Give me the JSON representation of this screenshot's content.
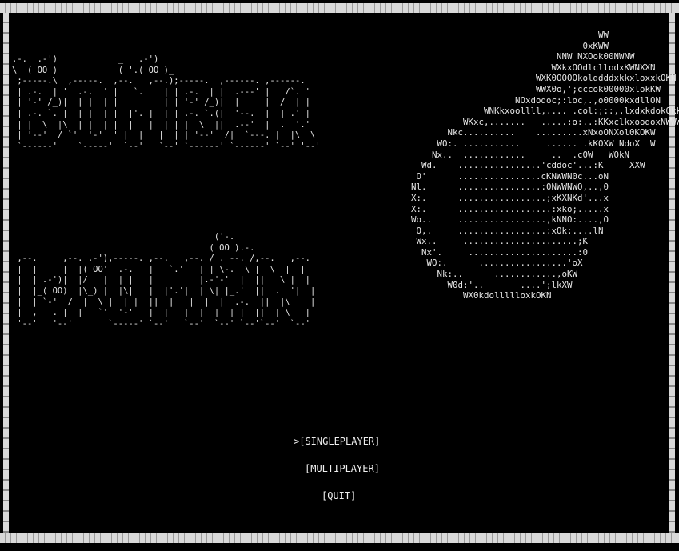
{
  "title": {
    "bomber_ascii": ".-.  .-')            _   .-')\n\\  ( OO )            ( '.( OO )_\n ;-----.\\  ,-----.  ,--.   ,--.);-----.  ,------. ,------.\n | .-.  | '  .-.  ' |   `.'   | | .-.  | |  .---' |   /`. '\n | '-' /_)|  | |  | |         | | '-' /_)|  |     |  /  | |\n | .-. `. |  | |  | |  |'.'|  | | .-. `.(|  '--.  |  |_.' |\n | |  \\  |\\  | |  | |  |   |  | | |  \\  ||  .--'  |  .  '.'\n | '--'  / `'  '-'  ' |  |   |  | | '--'  /|  `---. |  |\\  \\\n `------'    `-----'  `--'   `--' `------' `------' `--' '--'",
    "woman_ascii": "                                        ('-.\n                                       ( OO ).-.\n ,--.     ,--. .-'),-----. ,--.   ,--. / . --. /,--.   ,--.\n |  |     |  |( OO'  .-.  '|   `.'   | | \\-.  \\ |  \\  |  |\n |  | .-')|  |/   |  | |  ||         |.-'-'  |  ||   \\ |  |\n |  |_( OO)  |\\_) |  |\\|  ||  |'.'|  | \\| |_.'  ||  .  '|  |\n |  | `-'  /  |  \\ |  | |  ||  |   |  |  |  .-.  ||  |\\    |\n |  ,   . |  |   `'  '-'  '|  |   |  |  |  | |  ||  | \\   |\n '--'   '--'       `-----' `--'   `--'  `--' `--'`--'  `--'"
  },
  "bomb_ascii": "                                            WW\n                                         0xKWW\n                                    NNW NXOok00NWNW\n                                   WXkxOOdlcllodxKWNXXN\n                                WXK0OOOOkolddddxkkxloxxkOKN\n                                WWX0o,';cccok00000xlokKW\n                            NOxdodoc;:loc,.,o0000kxdllON\n                      WNKkxoollll,.... .col:;::,,lxdxkdokOkk0N\n                  WKxc,.......   .....:o:..:KKxclkxoodoxNWWWW\n               Nkc..........    .........xNxoONXol0KOKW\n             WO:. ...........     ...... .kKOXW NdoX  W\n            Nx..  ............     ..  .c0W   WOkN\n          Wd.    ................'cddoc'...:K     XXW\n         O'      ................cKNWWN0c...oN\n        Nl.      ................:0NWWNWO,..,0\n        X:.      .................;xKXNKd'...x\n        X:.      ..................:xko;.....x\n        Wo..     .................,kNNO:....,O\n         O,.     .................:xOk:....lN\n         Wx..     ......................;K\n          Nx'.     .....................:0\n           WO:.      .................'oX\n             Nk:..      ............,oKW\n               W0d:'..       ....';lkXW\n                  WX0kdollllloxkOKN",
  "menu": {
    "singleplayer": ">[SINGLEPLAYER]",
    "multiplayer": "[MULTIPLAYER]",
    "quit": "[QUIT]"
  },
  "colors": {
    "background": "#000000",
    "text": "#e6e6e6",
    "border": "#d8d8d8"
  }
}
